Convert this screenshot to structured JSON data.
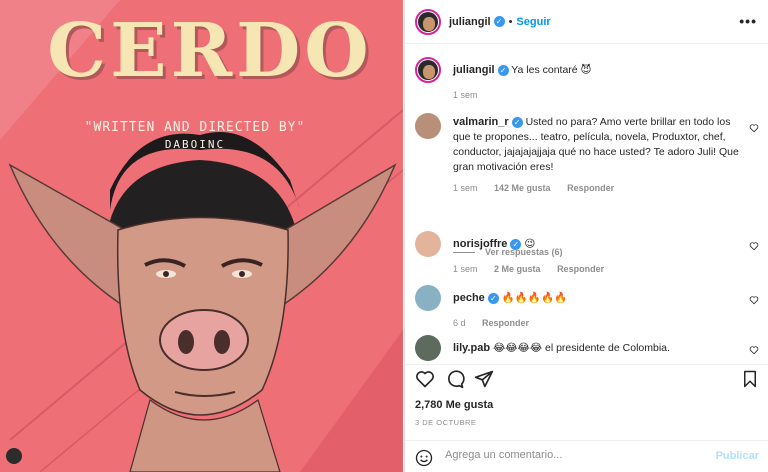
{
  "poster": {
    "title": "CERDO",
    "subtitle": "\"WRITTEN AND DIRECTED BY\"",
    "author": "DABOINC"
  },
  "header": {
    "username": "juliangil",
    "follow_label": "Seguir",
    "more_label": "•••"
  },
  "caption": {
    "username": "juliangil",
    "text": "Ya les contaré 😈",
    "time": "1 sem"
  },
  "comments": [
    {
      "username": "valmarin_r",
      "text": "Usted no para? Amo verte brillar en todo los que te propones... teatro, película, novela, Produxtor, chef, conductor, jajajajajjaja qué no hace usted? Te adoro Juli! Que gran motivación eres!",
      "time": "1 sem",
      "likes": "142 Me gusta",
      "reply": "Responder",
      "view_replies": "Ver respuestas (6)"
    },
    {
      "username": "norisjoffre",
      "text": "😉",
      "time": "1 sem",
      "likes": "2 Me gusta",
      "reply": "Responder"
    },
    {
      "username": "peche",
      "text": "🔥🔥🔥🔥🔥",
      "time": "6 d",
      "reply": "Responder"
    },
    {
      "username": "lily.pab",
      "text": "😂😂😂😂 el presidente de Colombia."
    }
  ],
  "stats": {
    "likes": "2,780 Me gusta",
    "date": "3 DE OCTUBRE"
  },
  "add_comment": {
    "placeholder": "Agrega un comentario...",
    "post_label": "Publicar"
  },
  "colors": {
    "accent": "#0095f6",
    "poster_bg": "#ef6f77",
    "verified": "#3897f0"
  }
}
